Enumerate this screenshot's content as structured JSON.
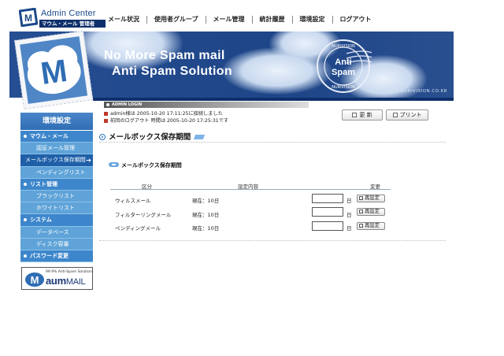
{
  "header": {
    "app_title": "Admin Center",
    "app_subtitle": "マウム・メール 管理者"
  },
  "topnav": {
    "items": [
      "メール状況",
      "使用者グループ",
      "メール管理",
      "統計履歴",
      "環境設定",
      "ログアウト"
    ]
  },
  "banner": {
    "line1": "No More Spam mail",
    "line2": "Anti Spam Solution",
    "stamp_line1": "Anti",
    "stamp_line2": "Spam",
    "stamp_ring": "NURIVISION",
    "url": "WWW.NURIVISION.CO.KR"
  },
  "sidebar": {
    "title": "環境設定",
    "items": [
      {
        "label": "マウム・メール",
        "type": "category"
      },
      {
        "label": "認証メール管理",
        "type": "item"
      },
      {
        "label": "メールボックス保存期間",
        "type": "active"
      },
      {
        "label": "ペンディングリスト",
        "type": "item"
      },
      {
        "label": "リスト管理",
        "type": "category"
      },
      {
        "label": "ブラックリスト",
        "type": "item"
      },
      {
        "label": "ホワイトリスト",
        "type": "item"
      },
      {
        "label": "システム",
        "type": "category"
      },
      {
        "label": "データベース",
        "type": "item"
      },
      {
        "label": "ディスク容量",
        "type": "item"
      },
      {
        "label": "パスワード変更",
        "type": "category"
      }
    ],
    "active_arrow": "➔"
  },
  "product_badge": {
    "tagline": "99.9% Anti-Spam Solution",
    "name_bold": "aum",
    "name_rest": "MAIL"
  },
  "login": {
    "header": "ADMIN LOGIN",
    "line1": "admin様は 2005-10-20 17:11:25に接続しました",
    "line2": "前回のログアウト 時間は 2005-10-20 17:25:31です"
  },
  "buttons": {
    "refresh": "更 新",
    "print": "プリント",
    "reset": "再設定"
  },
  "page": {
    "title": "メールボックス保存期間",
    "subtitle": "メールボックス保存期間"
  },
  "table": {
    "headers": [
      "区分",
      "設定内容",
      "変更"
    ],
    "unit": "日",
    "rows": [
      {
        "category": "ウィルスメール",
        "setting": "現在：10日",
        "value": ""
      },
      {
        "category": "フィルターリングメール",
        "setting": "現在：10日",
        "value": ""
      },
      {
        "category": "ペンディングメール",
        "setting": "現在：10日",
        "value": ""
      }
    ]
  },
  "colors": {
    "banner": "#1d4587",
    "menu": "#5fa3d8",
    "menu_category": "#3d86cb",
    "menu_active": "#1f5fa8"
  }
}
